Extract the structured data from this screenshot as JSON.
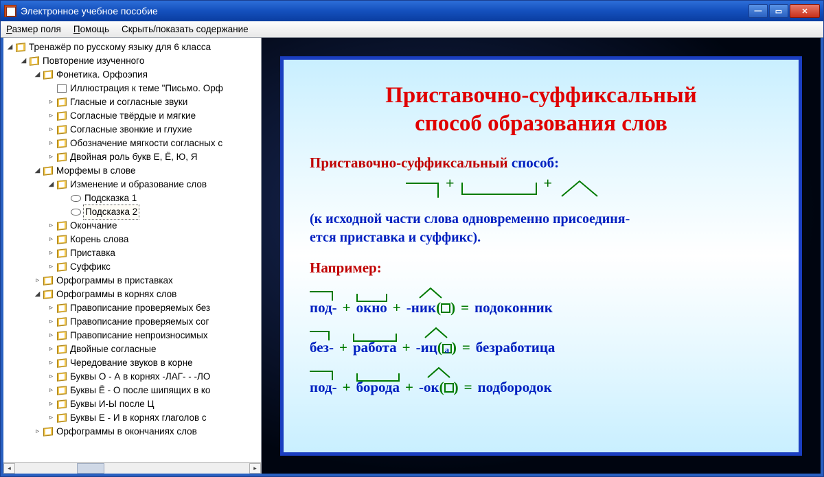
{
  "window": {
    "title": "Электронное учебное пособие"
  },
  "menu": {
    "field_size": "Размер поля",
    "help": "Помощь",
    "toggle_toc": "Скрыть/показать содержание"
  },
  "tree": {
    "root": "Тренажёр по русскому языку для 6 класса",
    "n1": "Повторение изученного",
    "n1_1": "Фонетика. Орфоэпия",
    "n1_1_1": "Иллюстрация к теме \"Письмо. Орф",
    "n1_1_2": "Гласные и согласные звуки",
    "n1_1_3": "Согласные твёрдые и мягкие",
    "n1_1_4": "Согласные звонкие и глухие",
    "n1_1_5": "Обозначение мягкости согласных с",
    "n1_1_6": "Двойная роль букв Е, Ё, Ю, Я",
    "n1_2": "Морфемы в слове",
    "n1_2_1": "Изменение и образование слов",
    "n1_2_1_1": "Подсказка 1",
    "n1_2_1_2": "Подсказка 2",
    "n1_2_2": "Окончание",
    "n1_2_3": "Корень слова",
    "n1_2_4": "Приставка",
    "n1_2_5": "Суффикс",
    "n1_3": "Орфограммы в приставках",
    "n1_4": "Орфограммы в корнях слов",
    "n1_4_1": "Правописание проверяемых без",
    "n1_4_2": "Правописание проверяемых сог",
    "n1_4_3": "Правописание непроизносимых",
    "n1_4_4": "Двойные согласные",
    "n1_4_5": "Чередование звуков в корне",
    "n1_4_6": "Буквы О - А в корнях -ЛАГ- - -ЛО",
    "n1_4_7": "Буквы Ё - О после шипящих в ко",
    "n1_4_8": "Буквы И-Ы после Ц",
    "n1_4_9": "Буквы Е - И в корнях глаголов с",
    "n1_5": "Орфограммы в окончаниях слов"
  },
  "slide": {
    "title_l1": "Приставочно-суффиксальный",
    "title_l2": "способ образования слов",
    "sub_red": "Приставочно-суффиксальный",
    "sub_blue": "способ:",
    "note_l1": "(к исходной части слова одновременно присоединя-",
    "note_l2": "ется приставка и суффикс).",
    "eg_label": "Например:",
    "ex1": {
      "prefix": "под-",
      "root": "окно",
      "suffix": "-ник",
      "result": "подоконник"
    },
    "ex2": {
      "prefix": "без-",
      "root": "работа",
      "suffix": "-иц",
      "box": "а",
      "result": "безработица"
    },
    "ex3": {
      "prefix": "под-",
      "root": "борода",
      "suffix": "-ок",
      "result": "подбородок"
    },
    "plus": "+",
    "eq": "=",
    "lp": "(",
    "rp": ")"
  }
}
